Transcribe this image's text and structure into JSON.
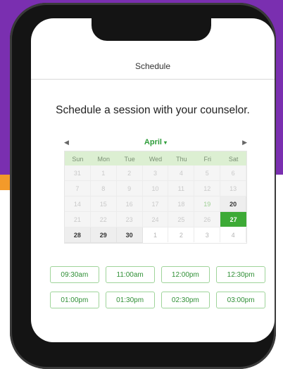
{
  "header": {
    "title": "Schedule"
  },
  "prompt": "Schedule a session with your counselor.",
  "calendar": {
    "month": "April",
    "dropdown_glyph": "▾",
    "prev_icon": "◀",
    "next_icon": "▶",
    "weekdays": [
      "Sun",
      "Mon",
      "Tue",
      "Wed",
      "Thu",
      "Fri",
      "Sat"
    ],
    "weeks": [
      [
        "31",
        "1",
        "2",
        "3",
        "4",
        "5",
        "6"
      ],
      [
        "7",
        "8",
        "9",
        "10",
        "11",
        "12",
        "13"
      ],
      [
        "14",
        "15",
        "16",
        "17",
        "18",
        "19",
        "20"
      ],
      [
        "21",
        "22",
        "23",
        "24",
        "25",
        "26",
        "27"
      ],
      [
        "28",
        "29",
        "30",
        "1",
        "2",
        "3",
        "4"
      ]
    ],
    "selected_day": "27"
  },
  "time_slots": [
    "09:30am",
    "11:00am",
    "12:00pm",
    "12:30pm",
    "01:00pm",
    "01:30pm",
    "02:30pm",
    "03:00pm"
  ],
  "colors": {
    "accent": "#3daa36",
    "purple_bg": "#7a2fb0",
    "orange_bg": "#f39a2a"
  }
}
